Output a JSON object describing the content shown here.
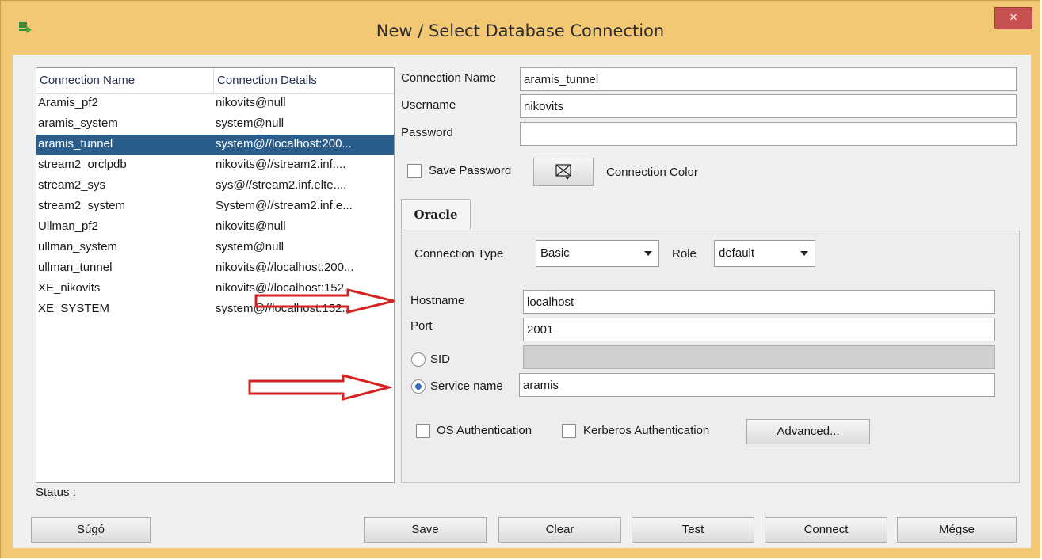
{
  "window": {
    "title": "New / Select Database Connection",
    "close_glyph": "×",
    "icon": "database-connection-icon"
  },
  "connections": {
    "headers": {
      "name": "Connection Name",
      "details": "Connection Details"
    },
    "rows": [
      {
        "name": "Aramis_pf2",
        "details": "nikovits@null"
      },
      {
        "name": "aramis_system",
        "details": "system@null"
      },
      {
        "name": "aramis_tunnel",
        "details": "system@//localhost:200...",
        "selected": true
      },
      {
        "name": "stream2_orclpdb",
        "details": "nikovits@//stream2.inf...."
      },
      {
        "name": "stream2_sys",
        "details": "sys@//stream2.inf.elte...."
      },
      {
        "name": "stream2_system",
        "details": "System@//stream2.inf.e..."
      },
      {
        "name": "Ullman_pf2",
        "details": "nikovits@null"
      },
      {
        "name": "ullman_system",
        "details": "system@null"
      },
      {
        "name": "ullman_tunnel",
        "details": "nikovits@//localhost:200..."
      },
      {
        "name": "XE_nikovits",
        "details": "nikovits@//localhost:152..."
      },
      {
        "name": "XE_SYSTEM",
        "details": "system@//localhost:152..."
      }
    ]
  },
  "form": {
    "connection_name_label": "Connection Name",
    "connection_name_value": "aramis_tunnel",
    "username_label": "Username",
    "username_value": "nikovits",
    "password_label": "Password",
    "password_value": "",
    "save_password_label": "Save Password",
    "save_password_checked": false,
    "connection_color_label": "Connection Color"
  },
  "oracle_tab": {
    "tab_label": "Oracle",
    "connection_type_label": "Connection Type",
    "connection_type_value": "Basic",
    "role_label": "Role",
    "role_value": "default",
    "hostname_label": "Hostname",
    "hostname_value": "localhost",
    "port_label": "Port",
    "port_value": "2001",
    "sid_label": "SID",
    "sid_value": "",
    "service_name_label": "Service name",
    "service_name_value": "aramis",
    "selected_radio": "service_name",
    "os_auth_label": "OS Authentication",
    "kerberos_auth_label": "Kerberos Authentication",
    "advanced_button": "Advanced..."
  },
  "status": {
    "label": "Status :"
  },
  "buttons": {
    "help": "Súgó",
    "save": "Save",
    "clear": "Clear",
    "test": "Test",
    "connect": "Connect",
    "cancel": "Mégse"
  },
  "colors": {
    "window_frame": "#f3c874",
    "close_button": "#c75050",
    "selection": "#2b5d8c",
    "annotation_arrow": "#d42020"
  }
}
